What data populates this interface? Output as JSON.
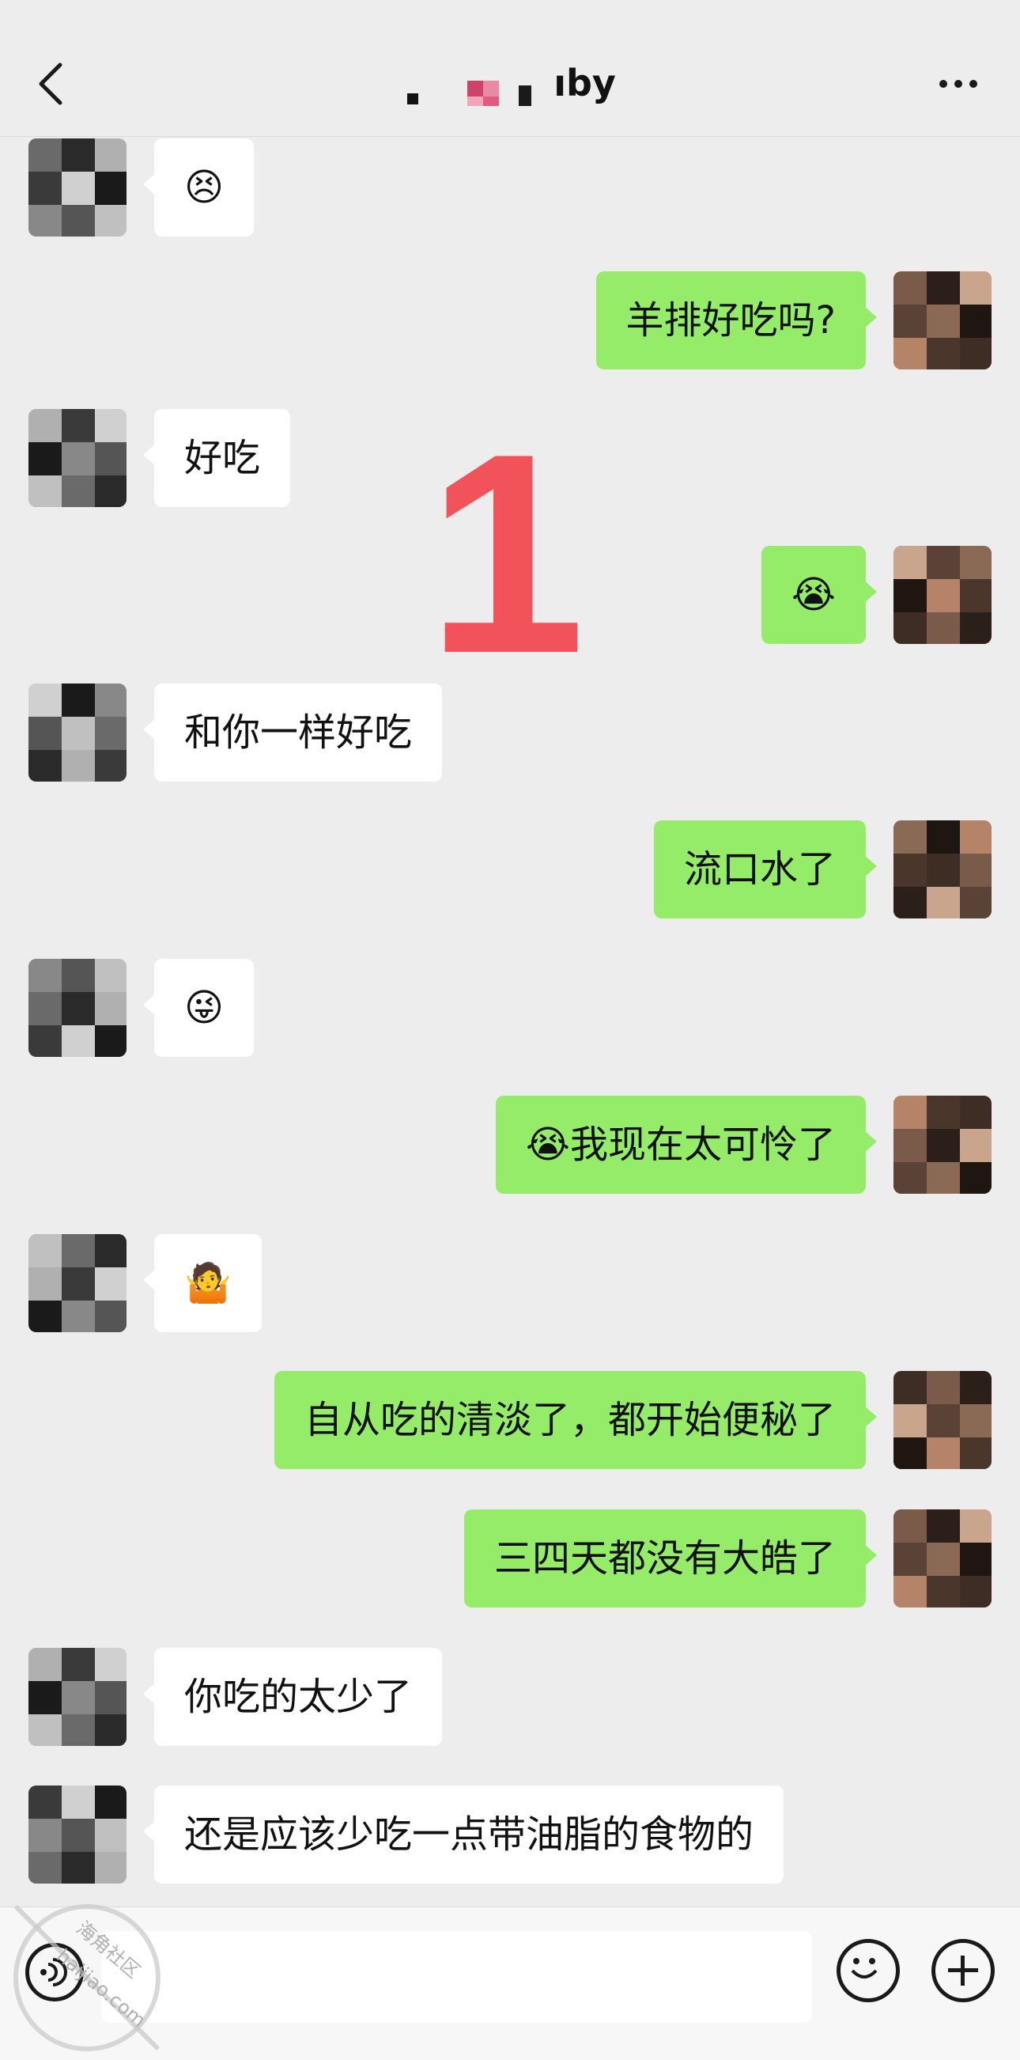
{
  "header": {
    "title_suffix": "ıby",
    "back_icon": "chevron-left-icon",
    "more_icon": "more-dots-icon"
  },
  "overlay_number": "1",
  "messages": [
    {
      "side": "left",
      "text": "😣"
    },
    {
      "side": "right",
      "text": "羊排好吃吗?"
    },
    {
      "side": "left",
      "text": "好吃"
    },
    {
      "side": "right",
      "text": "😭"
    },
    {
      "side": "left",
      "text": "和你一样好吃"
    },
    {
      "side": "right",
      "text": "流口水了"
    },
    {
      "side": "left",
      "text": "😜"
    },
    {
      "side": "right",
      "text": "😭我现在太可怜了"
    },
    {
      "side": "left",
      "text": "🤷"
    },
    {
      "side": "right",
      "text": "自从吃的清淡了，都开始便秘了"
    },
    {
      "side": "right",
      "text": "三四天都没有大皓了"
    },
    {
      "side": "left",
      "text": "你吃的太少了"
    },
    {
      "side": "left",
      "text": "还是应该少吃一点带油脂的食物的"
    }
  ],
  "input_bar": {
    "voice_icon": "voice-icon",
    "emoji_icon": "emoji-icon",
    "plus_icon": "plus-icon",
    "input_value": ""
  },
  "watermark": {
    "line1": "海角社区",
    "line2": "haijiao.com"
  },
  "colors": {
    "background": "#ededed",
    "sent_bubble": "#95ec69",
    "received_bubble": "#ffffff",
    "overlay_number": "#f2525a"
  }
}
